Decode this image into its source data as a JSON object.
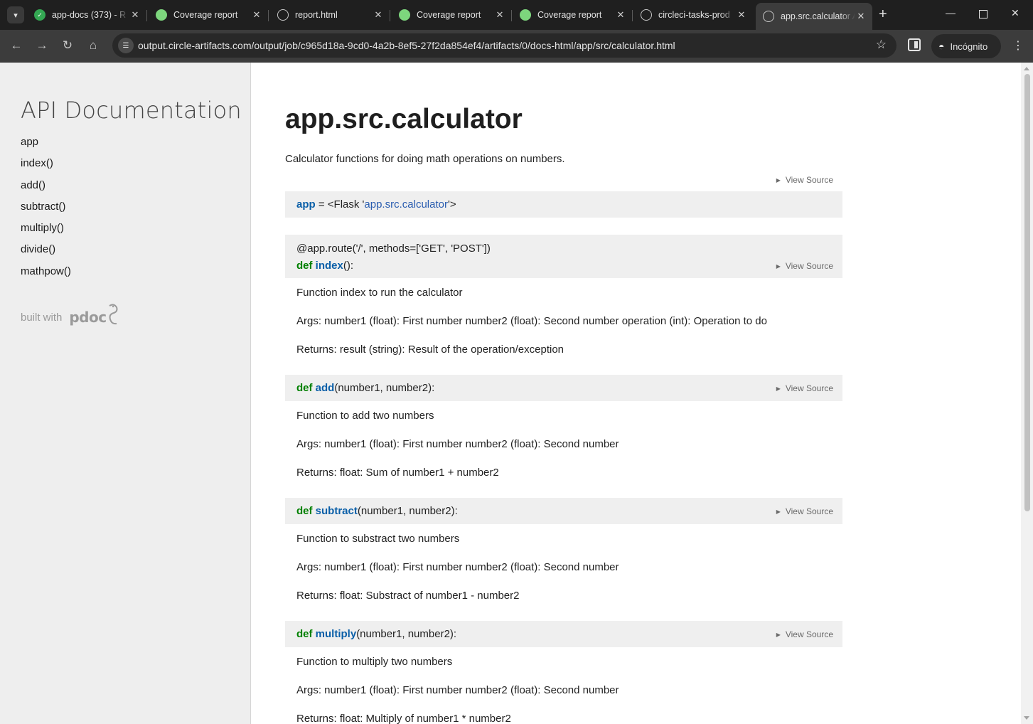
{
  "browser": {
    "tabs": [
      {
        "title": "app-docs (373) - R",
        "icon": "check-icon"
      },
      {
        "title": "Coverage report",
        "icon": "leaf-icon"
      },
      {
        "title": "report.html",
        "icon": "globe-icon"
      },
      {
        "title": "Coverage report",
        "icon": "leaf-icon"
      },
      {
        "title": "Coverage report",
        "icon": "leaf-icon"
      },
      {
        "title": "circleci-tasks-prod",
        "icon": "globe-icon"
      },
      {
        "title": "app.src.calculator A",
        "icon": "globe-icon",
        "active": true
      }
    ],
    "url": "output.circle-artifacts.com/output/job/c965d18a-9cd0-4a2b-8ef5-27f2da854ef4/artifacts/0/docs-html/app/src/calculator.html",
    "incognito_label": "Incógnito"
  },
  "sidebar": {
    "title": "API Documentation",
    "items": [
      "app",
      "index()",
      "add()",
      "subtract()",
      "multiply()",
      "divide()",
      "mathpow()"
    ],
    "built_with": "built with",
    "logo": "pdoc"
  },
  "module": {
    "name": "app.src.calculator",
    "doc": "Calculator functions for doing math operations on numbers.",
    "view_source": "View Source"
  },
  "app_var": {
    "name": "app",
    "eq": " = <Flask '",
    "value": "app.src.calculator",
    "tail": "'>"
  },
  "functions": [
    {
      "decorator": "@app.route('/', methods=['GET', 'POST'])",
      "kw": "def",
      "name": "index",
      "params": "():",
      "doc": [
        "Function index to run the calculator",
        "Args: number1 (float): First number number2 (float): Second number operation (int): Operation to do",
        "Returns: result (string): Result of the operation/exception"
      ]
    },
    {
      "kw": "def",
      "name": "add",
      "params": "(number1, number2):",
      "doc": [
        "Function to add two numbers",
        "Args: number1 (float): First number number2 (float): Second number",
        "Returns: float: Sum of number1 + number2"
      ]
    },
    {
      "kw": "def",
      "name": "subtract",
      "params": "(number1, number2):",
      "doc": [
        "Function to substract two numbers",
        "Args: number1 (float): First number number2 (float): Second number",
        "Returns: float: Substract of number1 - number2"
      ]
    },
    {
      "kw": "def",
      "name": "multiply",
      "params": "(number1, number2):",
      "doc": [
        "Function to multiply two numbers",
        "Args: number1 (float): First number number2 (float): Second number",
        "Returns: float: Multiply of number1 * number2"
      ]
    }
  ]
}
